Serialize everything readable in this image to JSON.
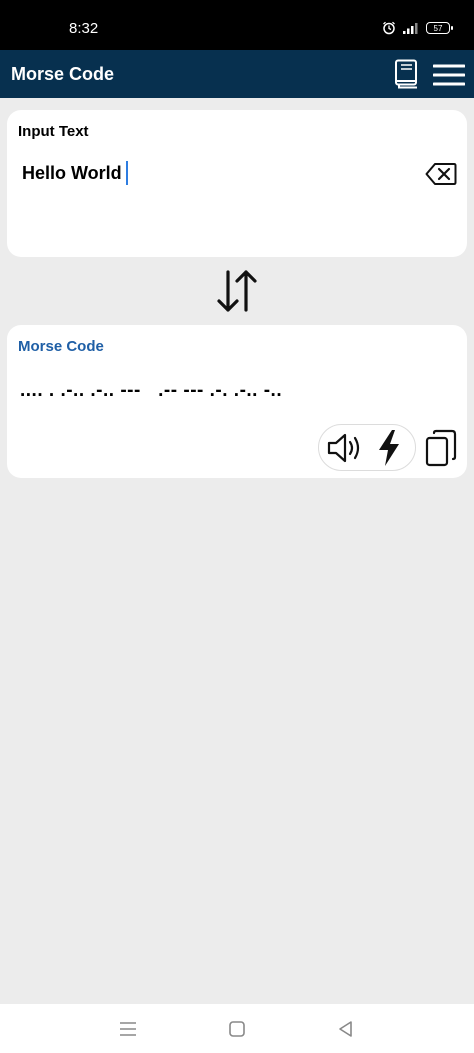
{
  "status_bar": {
    "time": "8:32",
    "battery": "57"
  },
  "app_bar": {
    "title": "Morse Code"
  },
  "input_card": {
    "label": "Input Text",
    "value": "Hello World"
  },
  "output_card": {
    "label": "Morse Code",
    "value": ".... . .-.. .-.. ---   .-- --- .-. .-.. -.."
  },
  "colors": {
    "app_bar_bg": "#07304f",
    "output_label": "#1f5fa6",
    "cursor": "#2e7de1",
    "background": "#ececec"
  },
  "icons": [
    "alarm-icon",
    "signal-icon",
    "battery-icon",
    "book-icon",
    "menu-icon",
    "clear-icon",
    "swap-icon",
    "speaker-icon",
    "flash-icon",
    "copy-icon",
    "nav-menu-icon",
    "nav-home-icon",
    "nav-back-icon"
  ]
}
